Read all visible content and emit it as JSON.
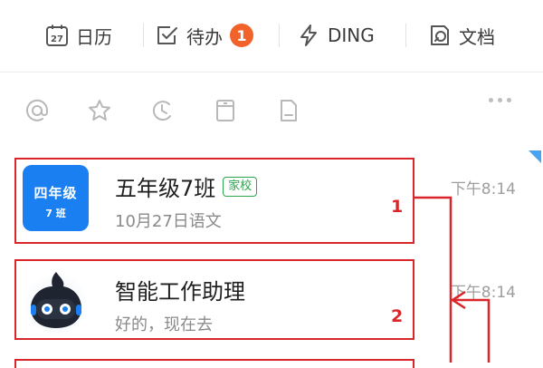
{
  "toolbar": {
    "items": [
      {
        "label": "日历",
        "icon": "calendar-icon",
        "icon_text": "27"
      },
      {
        "label": "待办",
        "icon": "todo-check-icon",
        "badge": "1"
      },
      {
        "label": "DING",
        "icon": "lightning-icon"
      },
      {
        "label": "文档",
        "icon": "document-icon"
      }
    ],
    "badge_color": "#f2622b"
  },
  "quick_icons": [
    "at-icon",
    "star-icon",
    "clock-icon",
    "archive-icon",
    "file-icon",
    "more-icon"
  ],
  "chats": [
    {
      "avatar_line1": "四年级",
      "avatar_line2": "7 班",
      "title": "五年级7班",
      "tag": "家校",
      "subtitle": "10月27日语文",
      "time": "下午8:14"
    },
    {
      "title": "智能工作助理",
      "subtitle": "好的，现在去",
      "time": "下午8:14"
    }
  ],
  "annotations": {
    "labels": [
      "1",
      "2"
    ],
    "color": "#d9262b"
  },
  "colors": {
    "accent_blue": "#1a7ff0",
    "tag_green": "#2ea44f"
  }
}
